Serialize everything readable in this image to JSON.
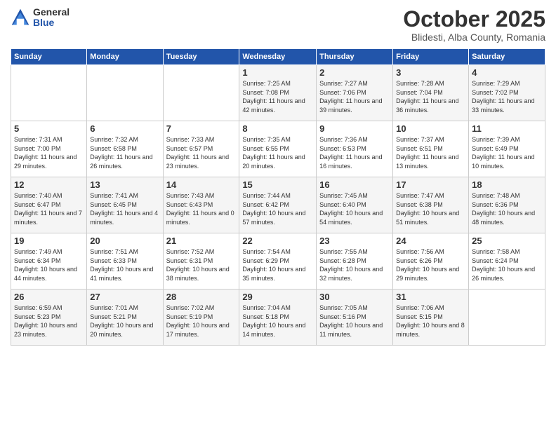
{
  "header": {
    "logo_general": "General",
    "logo_blue": "Blue",
    "month_title": "October 2025",
    "subtitle": "Blidesti, Alba County, Romania"
  },
  "weekdays": [
    "Sunday",
    "Monday",
    "Tuesday",
    "Wednesday",
    "Thursday",
    "Friday",
    "Saturday"
  ],
  "weeks": [
    [
      {
        "day": "",
        "info": ""
      },
      {
        "day": "",
        "info": ""
      },
      {
        "day": "",
        "info": ""
      },
      {
        "day": "1",
        "info": "Sunrise: 7:25 AM\nSunset: 7:08 PM\nDaylight: 11 hours and 42 minutes."
      },
      {
        "day": "2",
        "info": "Sunrise: 7:27 AM\nSunset: 7:06 PM\nDaylight: 11 hours and 39 minutes."
      },
      {
        "day": "3",
        "info": "Sunrise: 7:28 AM\nSunset: 7:04 PM\nDaylight: 11 hours and 36 minutes."
      },
      {
        "day": "4",
        "info": "Sunrise: 7:29 AM\nSunset: 7:02 PM\nDaylight: 11 hours and 33 minutes."
      }
    ],
    [
      {
        "day": "5",
        "info": "Sunrise: 7:31 AM\nSunset: 7:00 PM\nDaylight: 11 hours and 29 minutes."
      },
      {
        "day": "6",
        "info": "Sunrise: 7:32 AM\nSunset: 6:58 PM\nDaylight: 11 hours and 26 minutes."
      },
      {
        "day": "7",
        "info": "Sunrise: 7:33 AM\nSunset: 6:57 PM\nDaylight: 11 hours and 23 minutes."
      },
      {
        "day": "8",
        "info": "Sunrise: 7:35 AM\nSunset: 6:55 PM\nDaylight: 11 hours and 20 minutes."
      },
      {
        "day": "9",
        "info": "Sunrise: 7:36 AM\nSunset: 6:53 PM\nDaylight: 11 hours and 16 minutes."
      },
      {
        "day": "10",
        "info": "Sunrise: 7:37 AM\nSunset: 6:51 PM\nDaylight: 11 hours and 13 minutes."
      },
      {
        "day": "11",
        "info": "Sunrise: 7:39 AM\nSunset: 6:49 PM\nDaylight: 11 hours and 10 minutes."
      }
    ],
    [
      {
        "day": "12",
        "info": "Sunrise: 7:40 AM\nSunset: 6:47 PM\nDaylight: 11 hours and 7 minutes."
      },
      {
        "day": "13",
        "info": "Sunrise: 7:41 AM\nSunset: 6:45 PM\nDaylight: 11 hours and 4 minutes."
      },
      {
        "day": "14",
        "info": "Sunrise: 7:43 AM\nSunset: 6:43 PM\nDaylight: 11 hours and 0 minutes."
      },
      {
        "day": "15",
        "info": "Sunrise: 7:44 AM\nSunset: 6:42 PM\nDaylight: 10 hours and 57 minutes."
      },
      {
        "day": "16",
        "info": "Sunrise: 7:45 AM\nSunset: 6:40 PM\nDaylight: 10 hours and 54 minutes."
      },
      {
        "day": "17",
        "info": "Sunrise: 7:47 AM\nSunset: 6:38 PM\nDaylight: 10 hours and 51 minutes."
      },
      {
        "day": "18",
        "info": "Sunrise: 7:48 AM\nSunset: 6:36 PM\nDaylight: 10 hours and 48 minutes."
      }
    ],
    [
      {
        "day": "19",
        "info": "Sunrise: 7:49 AM\nSunset: 6:34 PM\nDaylight: 10 hours and 44 minutes."
      },
      {
        "day": "20",
        "info": "Sunrise: 7:51 AM\nSunset: 6:33 PM\nDaylight: 10 hours and 41 minutes."
      },
      {
        "day": "21",
        "info": "Sunrise: 7:52 AM\nSunset: 6:31 PM\nDaylight: 10 hours and 38 minutes."
      },
      {
        "day": "22",
        "info": "Sunrise: 7:54 AM\nSunset: 6:29 PM\nDaylight: 10 hours and 35 minutes."
      },
      {
        "day": "23",
        "info": "Sunrise: 7:55 AM\nSunset: 6:28 PM\nDaylight: 10 hours and 32 minutes."
      },
      {
        "day": "24",
        "info": "Sunrise: 7:56 AM\nSunset: 6:26 PM\nDaylight: 10 hours and 29 minutes."
      },
      {
        "day": "25",
        "info": "Sunrise: 7:58 AM\nSunset: 6:24 PM\nDaylight: 10 hours and 26 minutes."
      }
    ],
    [
      {
        "day": "26",
        "info": "Sunrise: 6:59 AM\nSunset: 5:23 PM\nDaylight: 10 hours and 23 minutes."
      },
      {
        "day": "27",
        "info": "Sunrise: 7:01 AM\nSunset: 5:21 PM\nDaylight: 10 hours and 20 minutes."
      },
      {
        "day": "28",
        "info": "Sunrise: 7:02 AM\nSunset: 5:19 PM\nDaylight: 10 hours and 17 minutes."
      },
      {
        "day": "29",
        "info": "Sunrise: 7:04 AM\nSunset: 5:18 PM\nDaylight: 10 hours and 14 minutes."
      },
      {
        "day": "30",
        "info": "Sunrise: 7:05 AM\nSunset: 5:16 PM\nDaylight: 10 hours and 11 minutes."
      },
      {
        "day": "31",
        "info": "Sunrise: 7:06 AM\nSunset: 5:15 PM\nDaylight: 10 hours and 8 minutes."
      },
      {
        "day": "",
        "info": ""
      }
    ]
  ]
}
